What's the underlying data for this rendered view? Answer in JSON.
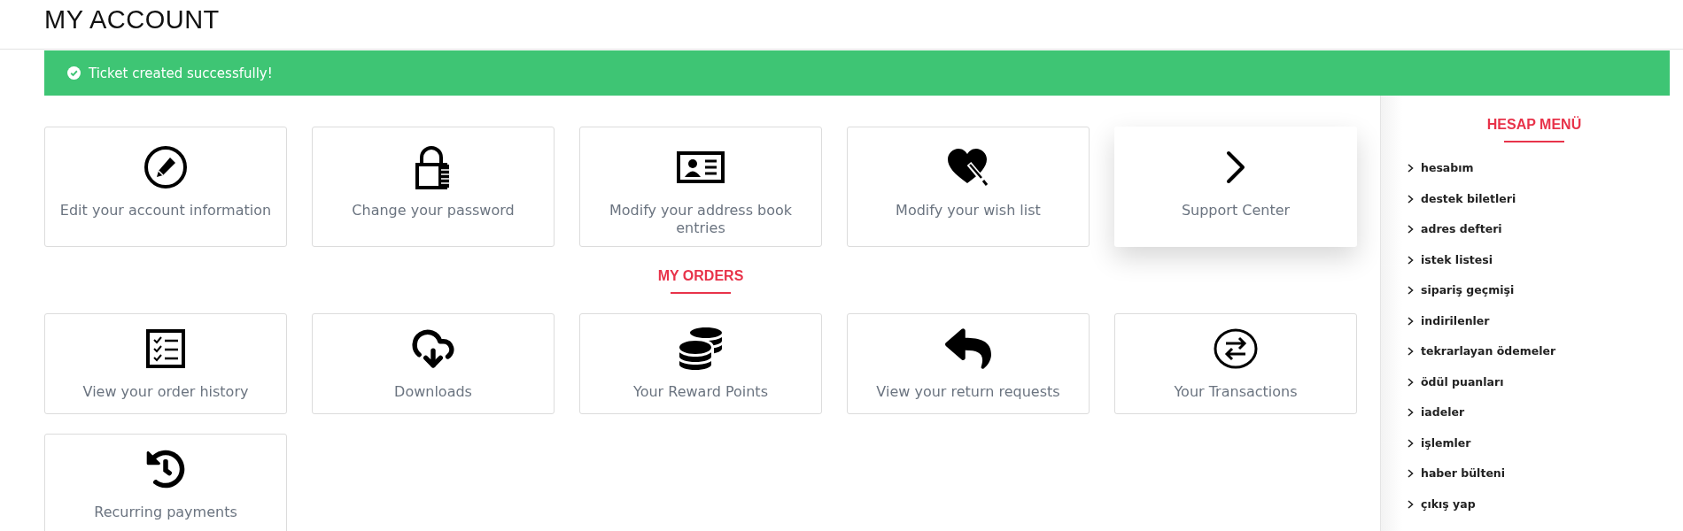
{
  "page_title": "MY ACCOUNT",
  "alert": {
    "kind": "success",
    "text": "Ticket created successfully!"
  },
  "account_links": [
    {
      "label": "Edit your account information",
      "highlighted": false
    },
    {
      "label": "Change your password",
      "highlighted": false
    },
    {
      "label": "Modify your address book entries",
      "highlighted": false
    },
    {
      "label": "Modify your wish list",
      "highlighted": false
    },
    {
      "label": "Support Center",
      "highlighted": true
    }
  ],
  "orders_section": {
    "title": "MY ORDERS",
    "links": [
      {
        "label": "View your order history",
        "highlighted": false
      },
      {
        "label": "Downloads",
        "highlighted": false
      },
      {
        "label": "Your Reward Points",
        "highlighted": false
      },
      {
        "label": "View your return requests",
        "highlighted": false
      },
      {
        "label": "Your Transactions",
        "highlighted": false
      },
      {
        "label": "Recurring payments",
        "highlighted": false
      }
    ]
  },
  "sidebar": {
    "title": "HESAP MENÜ",
    "items": [
      {
        "label": "hesabım"
      },
      {
        "label": "destek biletleri"
      },
      {
        "label": "adres defteri"
      },
      {
        "label": "istek listesi"
      },
      {
        "label": "sipariş geçmişi"
      },
      {
        "label": "indirilenler"
      },
      {
        "label": "tekrarlayan ödemeler"
      },
      {
        "label": "ödül puanları"
      },
      {
        "label": "iadeler"
      },
      {
        "label": "işlemler"
      },
      {
        "label": "haber bülteni"
      },
      {
        "label": "çıkış yap"
      }
    ]
  }
}
